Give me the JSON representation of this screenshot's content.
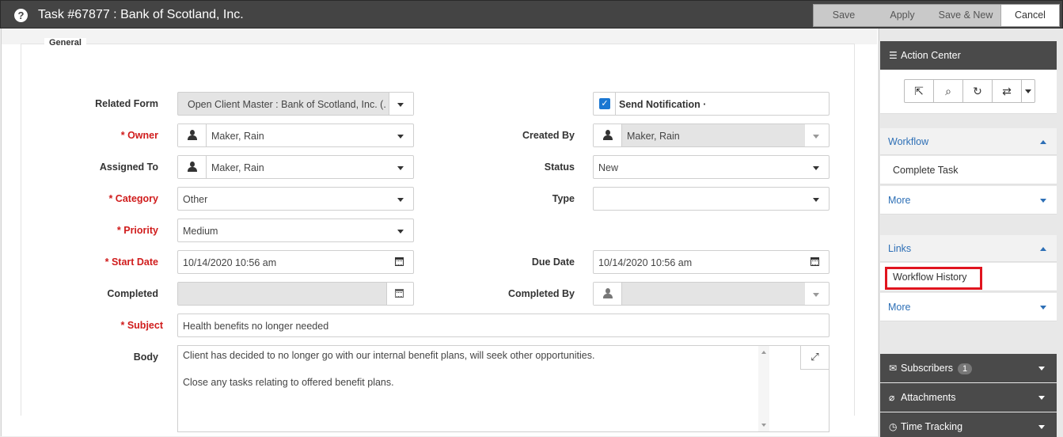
{
  "window": {
    "title": "Task #67877 : Bank of Scotland, Inc.",
    "actions": [
      {
        "label": "Save"
      },
      {
        "label": "Apply"
      },
      {
        "label": "Save & New"
      },
      {
        "label": "Cancel"
      }
    ]
  },
  "form": {
    "legend": "General",
    "related_form": {
      "label": "Related Form",
      "value": "Open Client Master : Bank of Scotland, Inc. (..."
    },
    "send_notification": {
      "label": "Send Notification ·",
      "checked": true
    },
    "owner": {
      "label": "* Owner",
      "value": "Maker, Rain"
    },
    "created_by": {
      "label": "Created By",
      "value": "Maker, Rain"
    },
    "assigned_to": {
      "label": "Assigned To",
      "value": "Maker, Rain"
    },
    "status": {
      "label": "Status",
      "value": "New"
    },
    "category": {
      "label": "* Category",
      "value": "Other"
    },
    "type": {
      "label": "Type",
      "value": ""
    },
    "priority": {
      "label": "* Priority",
      "value": "Medium"
    },
    "start_date": {
      "label": "* Start Date",
      "value": "10/14/2020 10:56 am"
    },
    "due_date": {
      "label": "Due Date",
      "value": "10/14/2020 10:56 am"
    },
    "completed": {
      "label": "Completed",
      "value": ""
    },
    "completed_by": {
      "label": "Completed By",
      "value": ""
    },
    "subject": {
      "label": "* Subject",
      "value": "Health benefits no longer needed"
    },
    "body": {
      "label": "Body",
      "line1": "Client has decided to no longer go with our internal benefit plans, will seek other opportunities.",
      "line2": "Close any tasks relating to offered benefit plans."
    }
  },
  "sidebar": {
    "action_center": "Action Center",
    "workflow": {
      "title": "Workflow",
      "item": "Complete Task",
      "more": "More"
    },
    "links": {
      "title": "Links",
      "item": "Workflow History",
      "more": "More"
    },
    "subscribers": {
      "label": "Subscribers",
      "count": "1"
    },
    "attachments": {
      "label": "Attachments"
    },
    "time_tracking": {
      "label": "Time Tracking"
    }
  },
  "colors": {
    "required": "#d01c1c",
    "link": "#2d6fb6",
    "highlight": "#e0141e",
    "titlebar": "#444444"
  }
}
